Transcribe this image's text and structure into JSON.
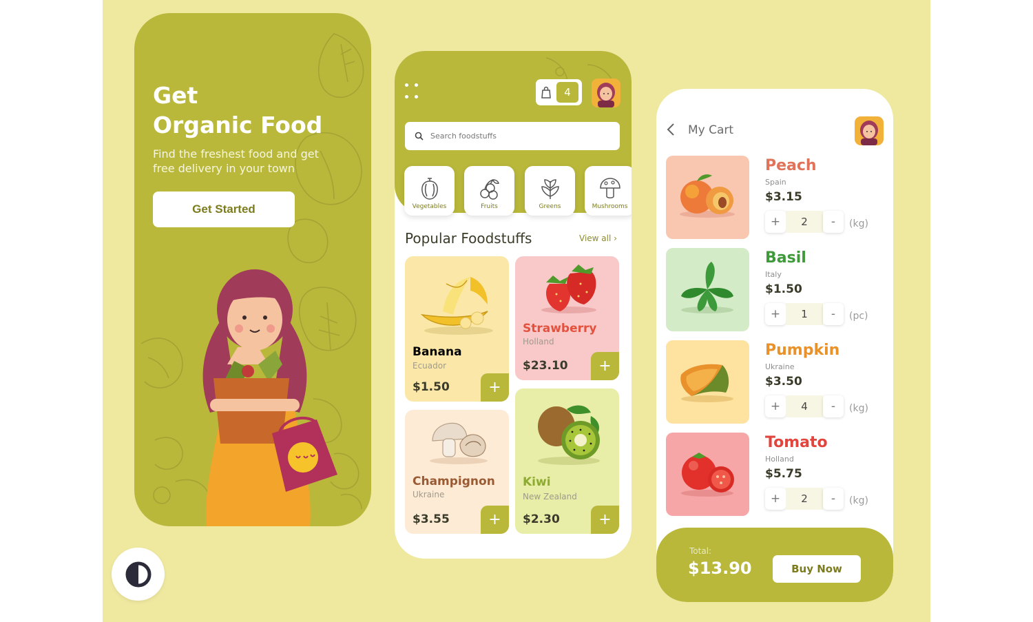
{
  "onboarding": {
    "title_line1": "Get",
    "title_line2": "Organic Food",
    "subtitle_line1": "Find the freshest food and get",
    "subtitle_line2": "free delivery in your town",
    "cta_label": "Get Started"
  },
  "catalog": {
    "cart_count": "4",
    "search_placeholder": "Search foodstuffs",
    "categories": [
      {
        "label": "Vegetables",
        "icon": "pepper-icon"
      },
      {
        "label": "Fruits",
        "icon": "cherries-icon"
      },
      {
        "label": "Greens",
        "icon": "leaf-icon"
      },
      {
        "label": "Mushrooms",
        "icon": "mushroom-icon"
      }
    ],
    "section_title": "Popular Foodstuffs",
    "view_all": "View all",
    "products": [
      {
        "name": "Banana",
        "origin": "Ecuador",
        "price": "$1.50",
        "color": "#e9a023"
      },
      {
        "name": "Strawberry",
        "origin": "Holland",
        "price": "$23.10",
        "color": "#e2523f"
      },
      {
        "name": "Champignon",
        "origin": "Ukraine",
        "price": "$3.55",
        "color": "#9a5a33"
      },
      {
        "name": "Kiwi",
        "origin": "New Zealand",
        "price": "$2.30",
        "color": "#8cab2f"
      }
    ],
    "add_symbol": "+"
  },
  "cart": {
    "title": "My Cart",
    "items": [
      {
        "name": "Peach",
        "origin": "Spain",
        "price": "$3.15",
        "qty": "2",
        "unit": "(kg)",
        "color": "#e0735a"
      },
      {
        "name": "Basil",
        "origin": "Italy",
        "price": "$1.50",
        "qty": "1",
        "unit": "(pc)",
        "color": "#3e9a3a"
      },
      {
        "name": "Pumpkin",
        "origin": "Ukraine",
        "price": "$3.50",
        "qty": "4",
        "unit": "(kg)",
        "color": "#e9912a"
      },
      {
        "name": "Tomato",
        "origin": "Holland",
        "price": "$5.75",
        "qty": "2",
        "unit": "(kg)",
        "color": "#e2453d"
      }
    ],
    "plus_symbol": "+",
    "minus_symbol": "-",
    "total_label": "Total:",
    "total_value": "$13.90",
    "buy_label": "Buy Now"
  },
  "colors": {
    "background": "#efe9a0",
    "brand": "#b9b83b",
    "accent_dark": "#7c7c1f"
  }
}
